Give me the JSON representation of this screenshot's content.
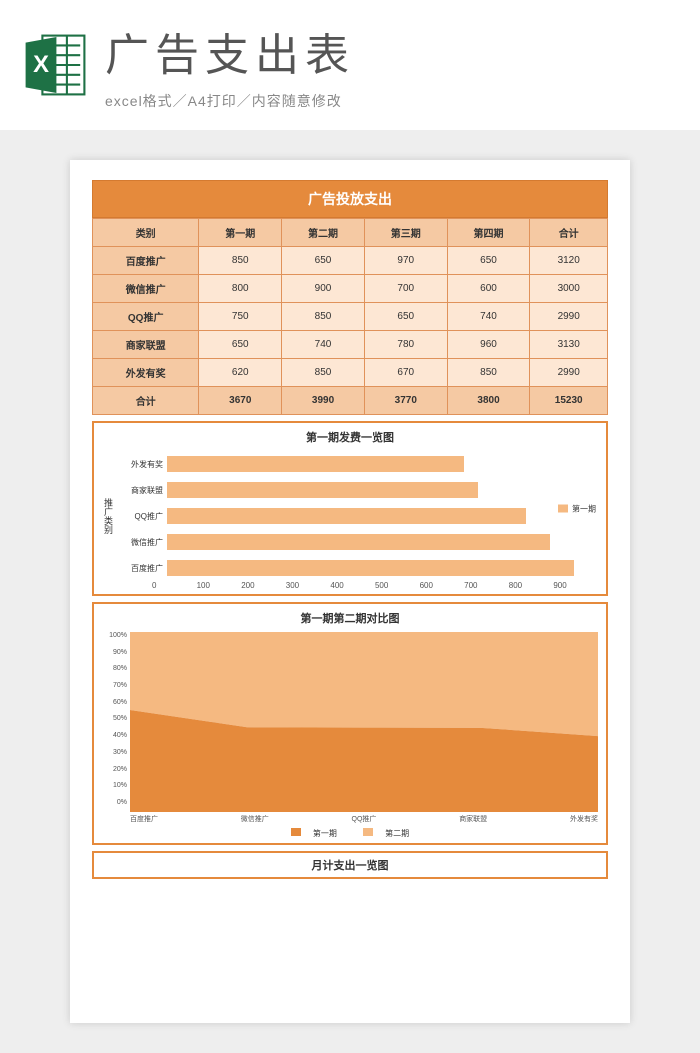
{
  "header": {
    "title": "广告支出表",
    "subtitle": "excel格式／A4打印／内容随意修改"
  },
  "sheet": {
    "title": "广告投放支出",
    "columns": [
      "类别",
      "第一期",
      "第二期",
      "第三期",
      "第四期",
      "合计"
    ],
    "rows": [
      {
        "name": "百度推广",
        "v": [
          850,
          650,
          970,
          650,
          3120
        ]
      },
      {
        "name": "微信推广",
        "v": [
          800,
          900,
          700,
          600,
          3000
        ]
      },
      {
        "name": "QQ推广",
        "v": [
          750,
          850,
          650,
          740,
          2990
        ]
      },
      {
        "name": "商家联盟",
        "v": [
          650,
          740,
          780,
          960,
          3130
        ]
      },
      {
        "name": "外发有奖",
        "v": [
          620,
          850,
          670,
          850,
          2990
        ]
      }
    ],
    "total": {
      "name": "合计",
      "v": [
        3670,
        3990,
        3770,
        3800,
        15230
      ]
    }
  },
  "chart_data": [
    {
      "type": "bar",
      "orientation": "horizontal",
      "title": "第一期发费一览图",
      "ylabel": "推广类别",
      "categories": [
        "外发有奖",
        "商家联盟",
        "QQ推广",
        "微信推广",
        "百度推广"
      ],
      "values": [
        620,
        650,
        750,
        800,
        850
      ],
      "xlim": [
        0,
        900
      ],
      "xticks": [
        0,
        100,
        200,
        300,
        400,
        500,
        600,
        700,
        800,
        900
      ],
      "legend": [
        "第一期"
      ]
    },
    {
      "type": "area",
      "stacked": "percent",
      "title": "第一期第二期对比图",
      "categories": [
        "百度推广",
        "微信推广",
        "QQ推广",
        "商家联盟",
        "外发有奖"
      ],
      "series": [
        {
          "name": "第一期",
          "values": [
            850,
            800,
            750,
            650,
            620
          ]
        },
        {
          "name": "第二期",
          "values": [
            650,
            900,
            850,
            740,
            850
          ]
        }
      ],
      "ylim": [
        0,
        100
      ],
      "yticks": [
        0,
        10,
        20,
        30,
        40,
        50,
        60,
        70,
        80,
        90,
        100
      ],
      "yformat": "percent"
    }
  ],
  "footer_chart_title": "月计支出一览图"
}
